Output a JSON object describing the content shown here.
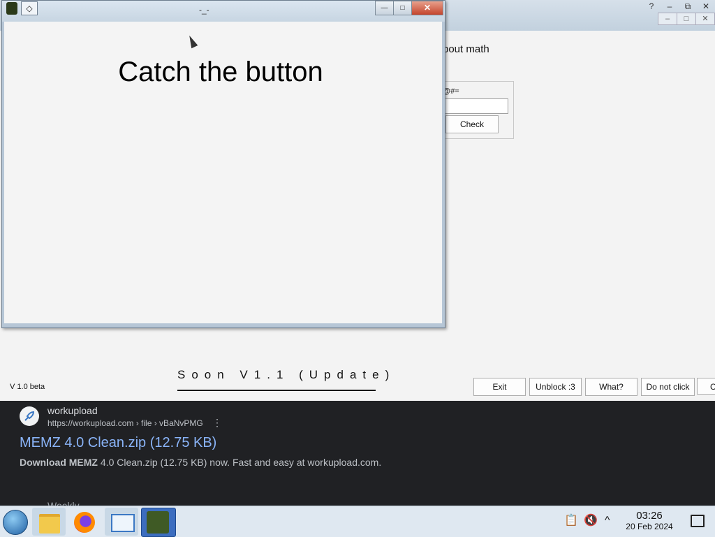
{
  "serp": {
    "site_name": "workupload",
    "url": "https://workupload.com › file › vBaNvPMG",
    "menu_icon": "⋮",
    "result_title": "MEMZ 4.0 Clean.zip (12.75 KB)",
    "snippet_bold": "Download MEMZ",
    "snippet_rest": " 4.0 Clean.zip (12.75 KB) now. Fast and easy at workupload.com.",
    "next_result": "Weekly"
  },
  "back_window": {
    "title_buttons": [
      "?",
      "–",
      "⧉",
      "✕"
    ],
    "inner_buttons": [
      "–",
      "□",
      "✕"
    ],
    "about_text": "bout math",
    "group_label": "@#=",
    "check_label": "Check",
    "version": "V 1.0 beta",
    "soon_text": "Soon V1.1 (Update)",
    "buttons": [
      "Exit",
      "Unblock :3",
      "What?",
      "Do not click",
      "C"
    ]
  },
  "dialog": {
    "title": "-_-",
    "diamond_icon": "◇",
    "minimize": "—",
    "maximize": "□",
    "close": "✕",
    "heading": "Catch the button"
  },
  "taskbar": {
    "apps": [
      "start-orb",
      "file-explorer",
      "firefox",
      "remote-desktop",
      "prank-app"
    ],
    "tray": {
      "clipboard": "📋",
      "volume_muted": "🔇",
      "chevron": "^"
    },
    "time": "03:26",
    "date": "20 Feb 2024"
  }
}
